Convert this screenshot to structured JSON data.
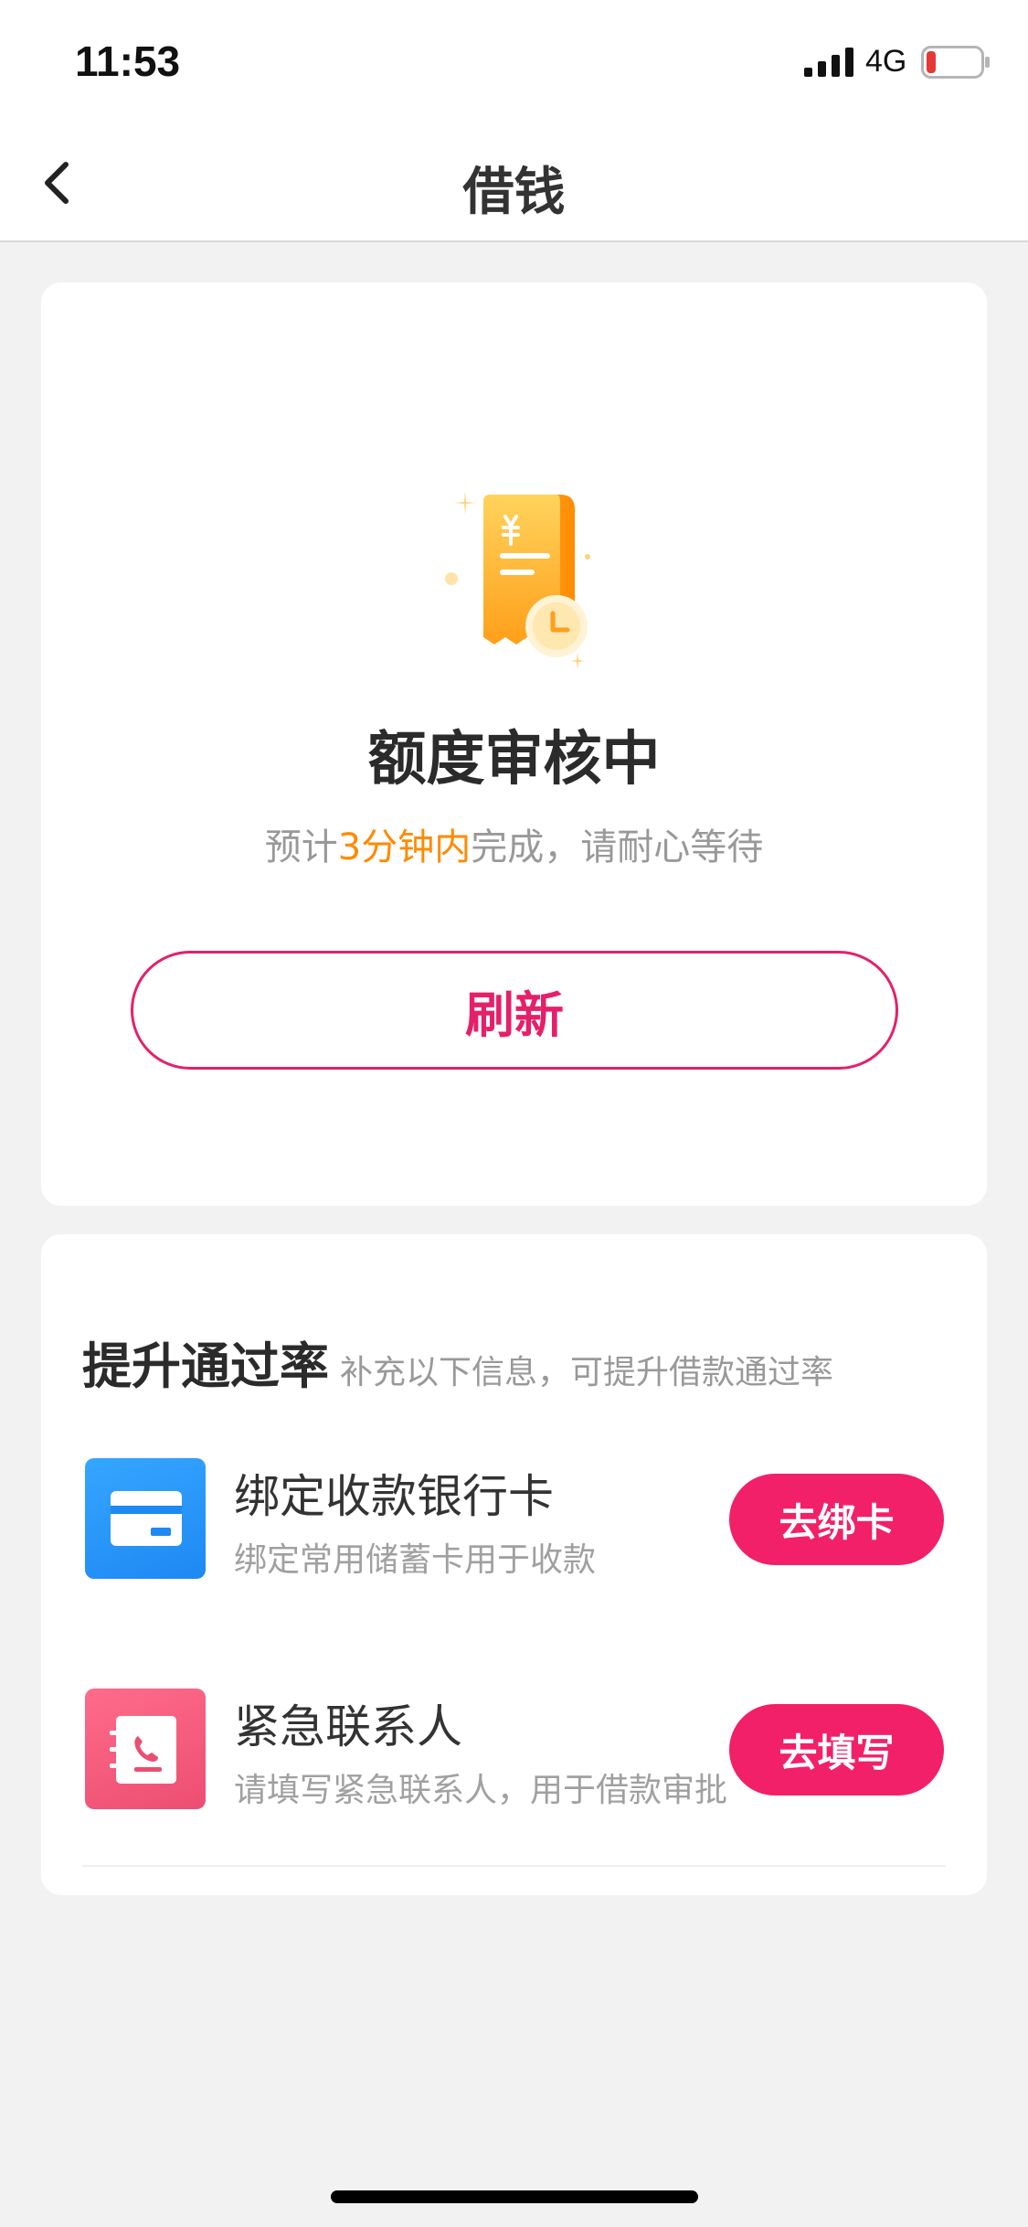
{
  "status_bar": {
    "time": "11:53",
    "network": "4G",
    "icons": [
      "signal-icon",
      "battery-icon"
    ],
    "battery_color": "#e53935"
  },
  "nav": {
    "title": "借钱",
    "back_icon": "back-chevron-icon"
  },
  "review": {
    "icon": "receipt-clock-icon",
    "title": "额度审核中",
    "subtitle_prefix": "预计",
    "subtitle_highlight": "3分钟内",
    "subtitle_suffix": "完成，请耐心等待",
    "refresh_label": "刷新"
  },
  "improve": {
    "title": "提升通过率",
    "subtitle": "补充以下信息，可提升借款通过率",
    "tasks": [
      {
        "icon": "bank-card-icon",
        "title": "绑定收款银行卡",
        "desc": "绑定常用储蓄卡用于收款",
        "button": "去绑卡"
      },
      {
        "icon": "contact-book-icon",
        "title": "紧急联系人",
        "desc": "请填写紧急联系人，用于借款审批",
        "button": "去填写"
      }
    ]
  },
  "colors": {
    "accent": "#f22068",
    "highlight": "#ff8a00",
    "background": "#f2f2f2"
  }
}
